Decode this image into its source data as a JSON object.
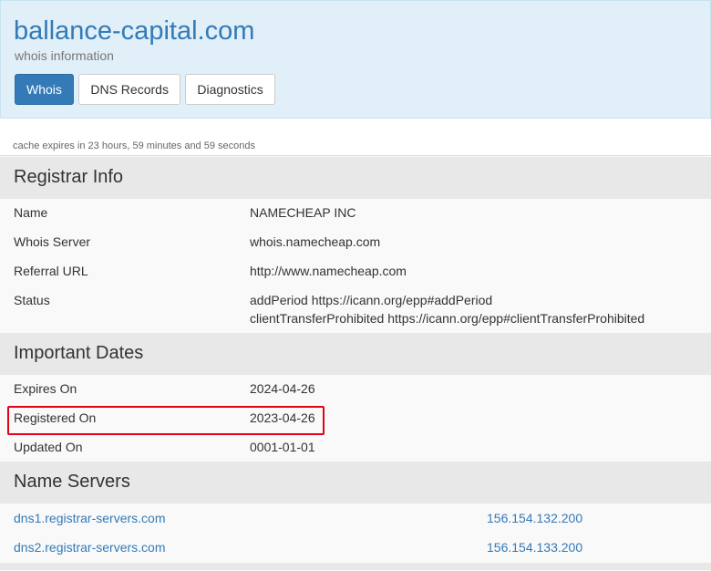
{
  "header": {
    "domain": "ballance-capital.com",
    "subtitle": "whois information",
    "tabs": [
      {
        "label": "Whois",
        "active": true
      },
      {
        "label": "DNS Records",
        "active": false
      },
      {
        "label": "Diagnostics",
        "active": false
      }
    ]
  },
  "cache_note": "cache expires in 23 hours, 59 minutes and 59 seconds",
  "registrar": {
    "heading": "Registrar Info",
    "rows": [
      {
        "label": "Name",
        "value": "NAMECHEAP INC"
      },
      {
        "label": "Whois Server",
        "value": "whois.namecheap.com"
      },
      {
        "label": "Referral URL",
        "value": "http://www.namecheap.com"
      },
      {
        "label": "Status",
        "value": "addPeriod https://icann.org/epp#addPeriod",
        "value2": "clientTransferProhibited https://icann.org/epp#clientTransferProhibited"
      }
    ]
  },
  "dates": {
    "heading": "Important Dates",
    "rows": [
      {
        "label": "Expires On",
        "value": "2024-04-26"
      },
      {
        "label": "Registered On",
        "value": "2023-04-26"
      },
      {
        "label": "Updated On",
        "value": "0001-01-01"
      }
    ]
  },
  "nameservers": {
    "heading": "Name Servers",
    "rows": [
      {
        "host": "dns1.registrar-servers.com",
        "ip": "156.154.132.200"
      },
      {
        "host": "dns2.registrar-servers.com",
        "ip": "156.154.133.200"
      }
    ]
  },
  "colors": {
    "accent": "#337ab7",
    "header_bg": "#e0eff8",
    "highlight": "#e3001b"
  }
}
